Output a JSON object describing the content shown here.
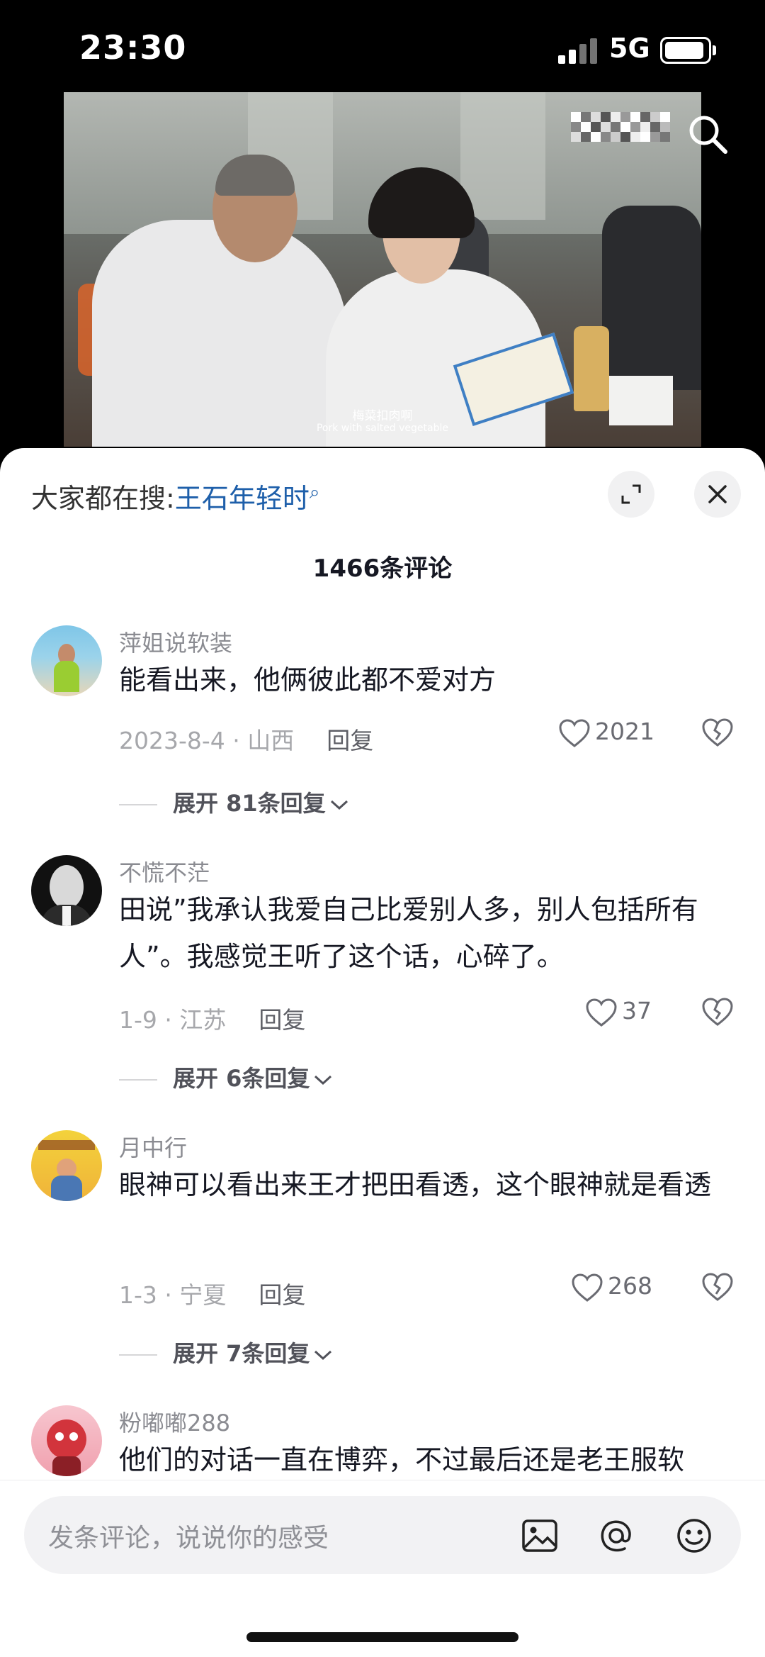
{
  "status": {
    "time": "23:30",
    "network": "5G"
  },
  "video": {
    "subtitle_zh": "梅菜扣肉啊",
    "subtitle_en": "Pork with salted vegetable"
  },
  "sheet": {
    "suggest_prefix": "大家都在搜:",
    "suggest_keyword": "王石年轻时",
    "comment_count": "1466条评论"
  },
  "comments": [
    {
      "user": "萍姐说软装",
      "text": "能看出来，他俩彼此都不爱对方",
      "meta": "2023-8-4 · 山西",
      "reply": "回复",
      "likes": "2021",
      "more": "展开 81条回复"
    },
    {
      "user": "不慌不茫",
      "text": "田说”我承认我爱自己比爱别人多，别人包括所有人”。我感觉王听了这个话，心碎了。",
      "meta": "1-9 · 江苏",
      "reply": "回复",
      "likes": "37",
      "more": "展开 6条回复"
    },
    {
      "user": "月中行",
      "text": "眼神可以看出来王才把田看透，这个眼神就是看透",
      "meta": "1-3 · 宁夏",
      "reply": "回复",
      "likes": "268",
      "more": "展开 7条回复"
    },
    {
      "user": "粉嘟嘟288",
      "text": "他们的对话一直在博弈，不过最后还是老王服软"
    }
  ],
  "input": {
    "placeholder": "发条评论，说说你的感受"
  },
  "icons": {
    "top_search": "search-icon",
    "expand": "expand-icon",
    "close": "close-icon",
    "like": "heart-icon",
    "dislike": "broken-heart-icon",
    "image": "image-icon",
    "mention": "at-icon",
    "emoji": "emoji-icon"
  },
  "colors": {
    "keyword": "#1e5faa",
    "text": "#161823",
    "muted": "#a6a7ab"
  }
}
